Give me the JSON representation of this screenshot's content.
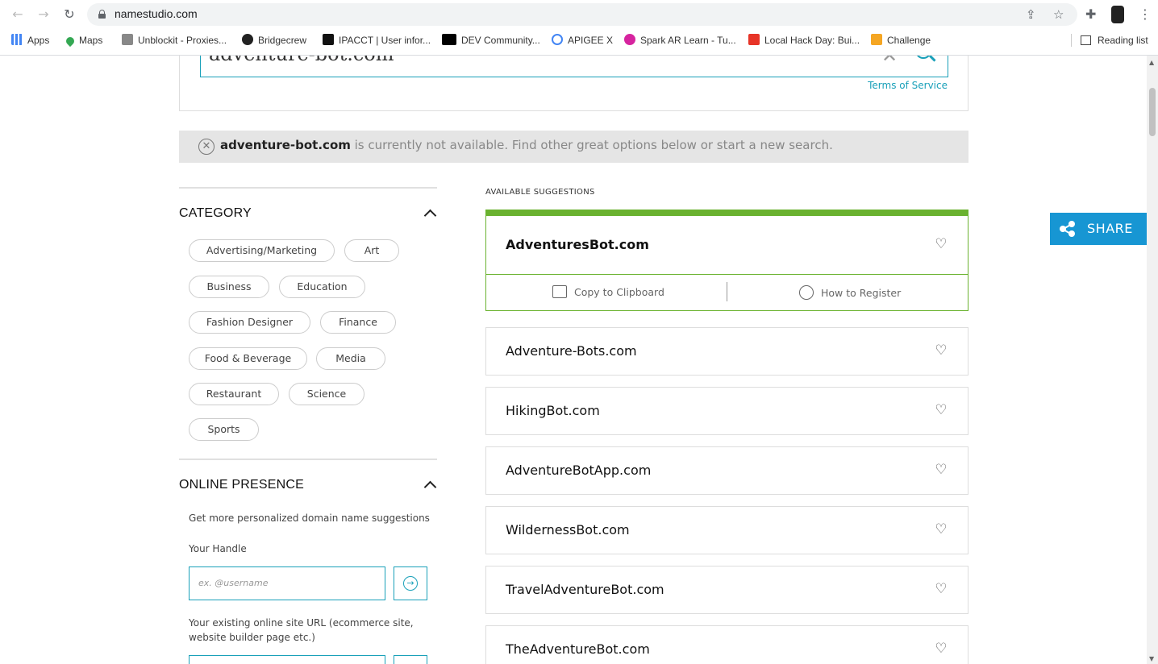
{
  "browser": {
    "url": "namestudio.com",
    "bookmarks": [
      {
        "label": "Apps",
        "icon": "apps-grid-icon"
      },
      {
        "label": "Maps",
        "icon": "maps-pin-icon"
      },
      {
        "label": "Unblockit - Proxies...",
        "icon": "unblockit-icon"
      },
      {
        "label": "Bridgecrew",
        "icon": "github-icon"
      },
      {
        "label": "IPACCT | User infor...",
        "icon": "ipacct-icon"
      },
      {
        "label": "DEV Community...",
        "icon": "dev-icon"
      },
      {
        "label": "APIGEE X",
        "icon": "google-cloud-icon"
      },
      {
        "label": "Spark AR Learn - Tu...",
        "icon": "spark-ar-icon"
      },
      {
        "label": "Local Hack Day: Bui...",
        "icon": "mlh-icon"
      },
      {
        "label": "Challenge",
        "icon": "mlh-icon"
      }
    ],
    "reading_list": "Reading list"
  },
  "search": {
    "query": "adventure-bot.com",
    "clear_symbol": "✕",
    "terms_link": "Terms of Service"
  },
  "alert": {
    "domain": "adventure-bot.com",
    "message": " is currently not available. Find other great options below or start a new search."
  },
  "category": {
    "title": "CATEGORY",
    "pills": [
      "Advertising/Marketing",
      "Art",
      "Business",
      "Education",
      "Fashion Designer",
      "Finance",
      "Food & Beverage",
      "Media",
      "Restaurant",
      "Science",
      "Sports"
    ]
  },
  "online_presence": {
    "title": "ONLINE PRESENCE",
    "description": "Get more personalized domain name suggestions",
    "handle_label": "Your Handle",
    "handle_placeholder": "ex. @username",
    "url_label": "Your existing online site URL (ecommerce site, website builder page etc.)"
  },
  "suggestions": {
    "heading": "AVAILABLE SUGGESTIONS",
    "featured": {
      "name": "AdventuresBot.com",
      "copy_label": "Copy to Clipboard",
      "register_label": "How to Register"
    },
    "items": [
      "Adventure-Bots.com",
      "HikingBot.com",
      "AdventureBotApp.com",
      "WildernessBot.com",
      "TravelAdventureBot.com",
      "TheAdventureBot.com"
    ]
  },
  "share": {
    "label": "SHARE"
  },
  "colors": {
    "accent": "#19a0b9",
    "featured_green": "#6ab22f",
    "share_blue": "#1796d3"
  }
}
